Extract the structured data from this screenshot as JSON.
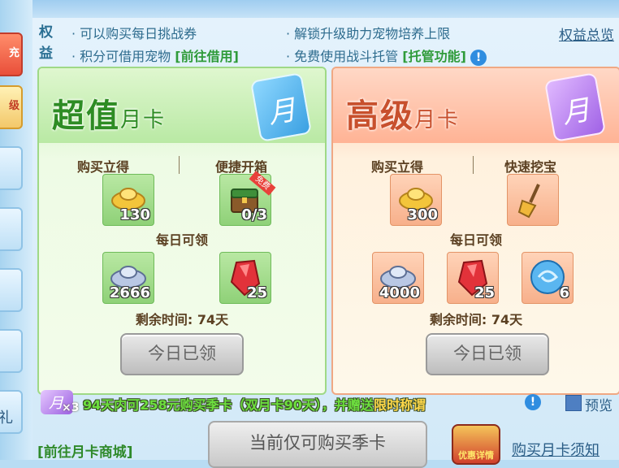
{
  "rights": {
    "label": "权益",
    "items": [
      "· 可以购买每日挑战券",
      "· 积分可借用宠物",
      "· 解锁升级助力宠物培养上限",
      "· 免费使用战斗托管"
    ],
    "borrow_link": "[前往借用]",
    "autoplay_link": "[托管功能]",
    "overview_link": "权益总览",
    "info_icon": "!"
  },
  "sidebar": {
    "tab_red_text": "充",
    "tab_gold_text": "级",
    "side_char": "礼"
  },
  "cards": {
    "normal": {
      "title_main": "超值",
      "title_sub": "月卡",
      "moon_char": "月",
      "col1_label": "购买立得",
      "col2_label": "便捷开箱",
      "gold_count": "130",
      "chest_count": "0/3",
      "free_tag": "免费",
      "daily_label": "每日可领",
      "silver_count": "2666",
      "gem_count": "25",
      "remain_label": "剩余时间: 74天",
      "claimed_label": "今日已领"
    },
    "premium": {
      "title_main": "高级",
      "title_sub": "月卡",
      "moon_char": "月",
      "col1_label": "购买立得",
      "col2_label": "快速挖宝",
      "gold_count": "300",
      "daily_label": "每日可领",
      "silver_count": "4000",
      "gem_count": "25",
      "orb_count": "6",
      "remain_label": "剩余时间: 74天",
      "claimed_label": "今日已领"
    }
  },
  "promo": {
    "moon_char": "月",
    "multiplier": "×3",
    "text_main": "94天内可258元购买季卡（双月卡90天），并赠送",
    "text_highlight": "限时称谓",
    "info_icon": "!",
    "preview_label": "预览"
  },
  "footer": {
    "shop_link": "[前往月卡商城]",
    "buy_button": "当前仅可购买季卡",
    "gift_label": "优惠详情",
    "notice_link": "购买月卡须知"
  },
  "colors": {
    "green_title": "#2e8c24",
    "orange_title": "#c8502d",
    "link_green": "#2f9b3a",
    "info_blue": "#2f8de0"
  }
}
